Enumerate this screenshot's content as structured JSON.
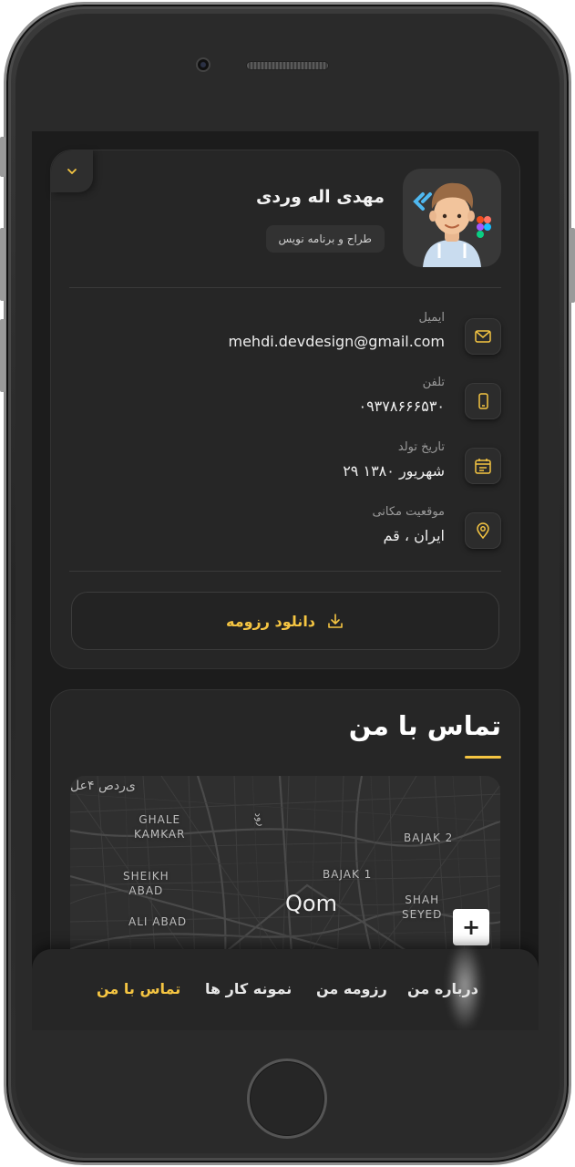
{
  "profile": {
    "name": "مهدی اله وردی",
    "role": "طراح و برنامه نویس",
    "avatar_icon": "developer-avatar-icon",
    "toggle_icon": "chevron-down-icon"
  },
  "info": [
    {
      "label": "ایمیل",
      "value": "mehdi.devdesign@gmail.com",
      "icon": "mail-icon"
    },
    {
      "label": "تلفن",
      "value": "۰۹۳۷۸۶۶۶۵۳۰",
      "icon": "phone-icon"
    },
    {
      "label": "تاریخ تولد",
      "value": "۲۹ شهریور ۱۳۸۰",
      "icon": "calendar-icon"
    },
    {
      "label": "موقعیت مکانی",
      "value": "ایران ، قم",
      "icon": "location-icon"
    }
  ],
  "download": {
    "label": "دانلود رزومه",
    "icon": "download-icon"
  },
  "contact": {
    "title": "تماس با من",
    "map": {
      "labels": {
        "top_left": "ی‌ردص ۴عل",
        "ghale": "GHALE\nKAMKAR",
        "sheikh": "SHEIKH\nABAD",
        "aliabad": "ALI ABAD",
        "bajak1": "BAJAK 1",
        "bajak2": "BAJAK 2",
        "shah": "SHAH\nSEYED",
        "road": "رود"
      },
      "city": "Qom",
      "zoom_in": "+"
    }
  },
  "nav": {
    "items": [
      {
        "label": "درباره من"
      },
      {
        "label": "رزومه من"
      },
      {
        "label": "نمونه کار ها"
      },
      {
        "label": "تماس با من"
      }
    ],
    "active_color": "#f5c542"
  },
  "colors": {
    "accent": "#f5c542",
    "background": "#1c1c1c",
    "card": "#262626"
  }
}
